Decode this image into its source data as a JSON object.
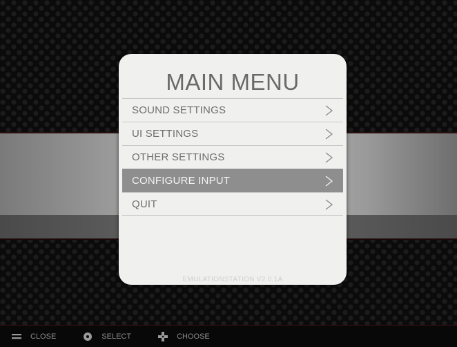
{
  "menu": {
    "title": "MAIN MENU",
    "items": [
      {
        "label": "SOUND SETTINGS",
        "selected": false
      },
      {
        "label": "UI SETTINGS",
        "selected": false
      },
      {
        "label": "OTHER SETTINGS",
        "selected": false
      },
      {
        "label": "CONFIGURE INPUT",
        "selected": true
      },
      {
        "label": "QUIT",
        "selected": false
      }
    ],
    "version": "EMULATIONSTATION V2.0.1A"
  },
  "help": [
    {
      "icon": "start-select-icon",
      "label": "CLOSE"
    },
    {
      "icon": "a-button-icon",
      "label": "SELECT"
    },
    {
      "icon": "dpad-icon",
      "label": "CHOOSE"
    }
  ],
  "colors": {
    "panel": "#f0f0ef",
    "selected_row": "#8e8e8e",
    "text": "#6e6e6e"
  }
}
